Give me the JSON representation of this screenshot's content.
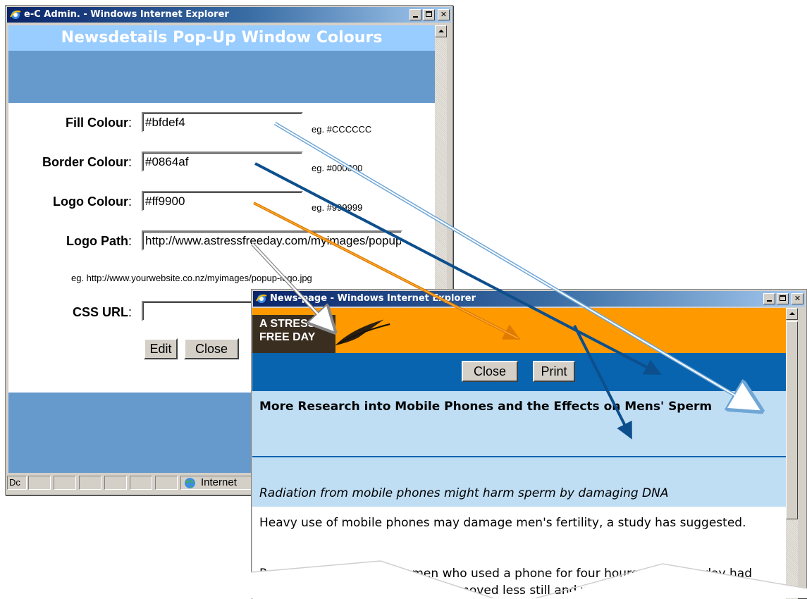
{
  "admin_window": {
    "title": "e-C Admin. - Windows Internet Explorer",
    "heading": "Newsdetails Pop-Up Window Colours",
    "fields": [
      {
        "label": "Fill Colour",
        "value": "#bfdef4",
        "example": "eg. #CCCCCC"
      },
      {
        "label": "Border Colour",
        "value": "#0864af",
        "example": "eg. #000000"
      },
      {
        "label": "Logo Colour",
        "value": "#ff9900",
        "example": "eg. #999999"
      },
      {
        "label": "Logo Path",
        "value": "http://www.astressfreeday.com/myimages/popup-logo.jpg",
        "example": ""
      }
    ],
    "logo_path_example": "eg. http://www.yourwebsite.co.nz/myimages/popup-logo.jpg",
    "css_url_label": "CSS URL",
    "css_url_value": "",
    "edit_button": "Edit",
    "close_button": "Close",
    "status_pane_text": "Dc",
    "status_zone": "Internet"
  },
  "news_window": {
    "title": "News-page - Windows Internet Explorer",
    "logo_line1": "A STRESS",
    "logo_line2": "FREE DAY",
    "close_button": "Close",
    "print_button": "Print",
    "headline": "More Research into Mobile Phones and the Effects on Mens' Sperm",
    "subheadline": "Radiation from mobile phones might harm sperm by damaging DNA",
    "paragraph1": "Heavy use of mobile phones may damage men's fertility, a study has suggested.",
    "paragraph2": "Researchers found those men who used a phone for four hours or more a day had lower sperm and those they had moved less still and were"
  },
  "colors": {
    "fill": "#bfdef4",
    "border": "#0864af",
    "logo": "#ff9900",
    "admin_header": "#99ccff",
    "admin_band": "#6699cc"
  },
  "icons": [
    "ie-icon",
    "minimize-icon",
    "maximize-icon",
    "close-icon",
    "globe-icon",
    "scroll-up-arrow-icon"
  ]
}
